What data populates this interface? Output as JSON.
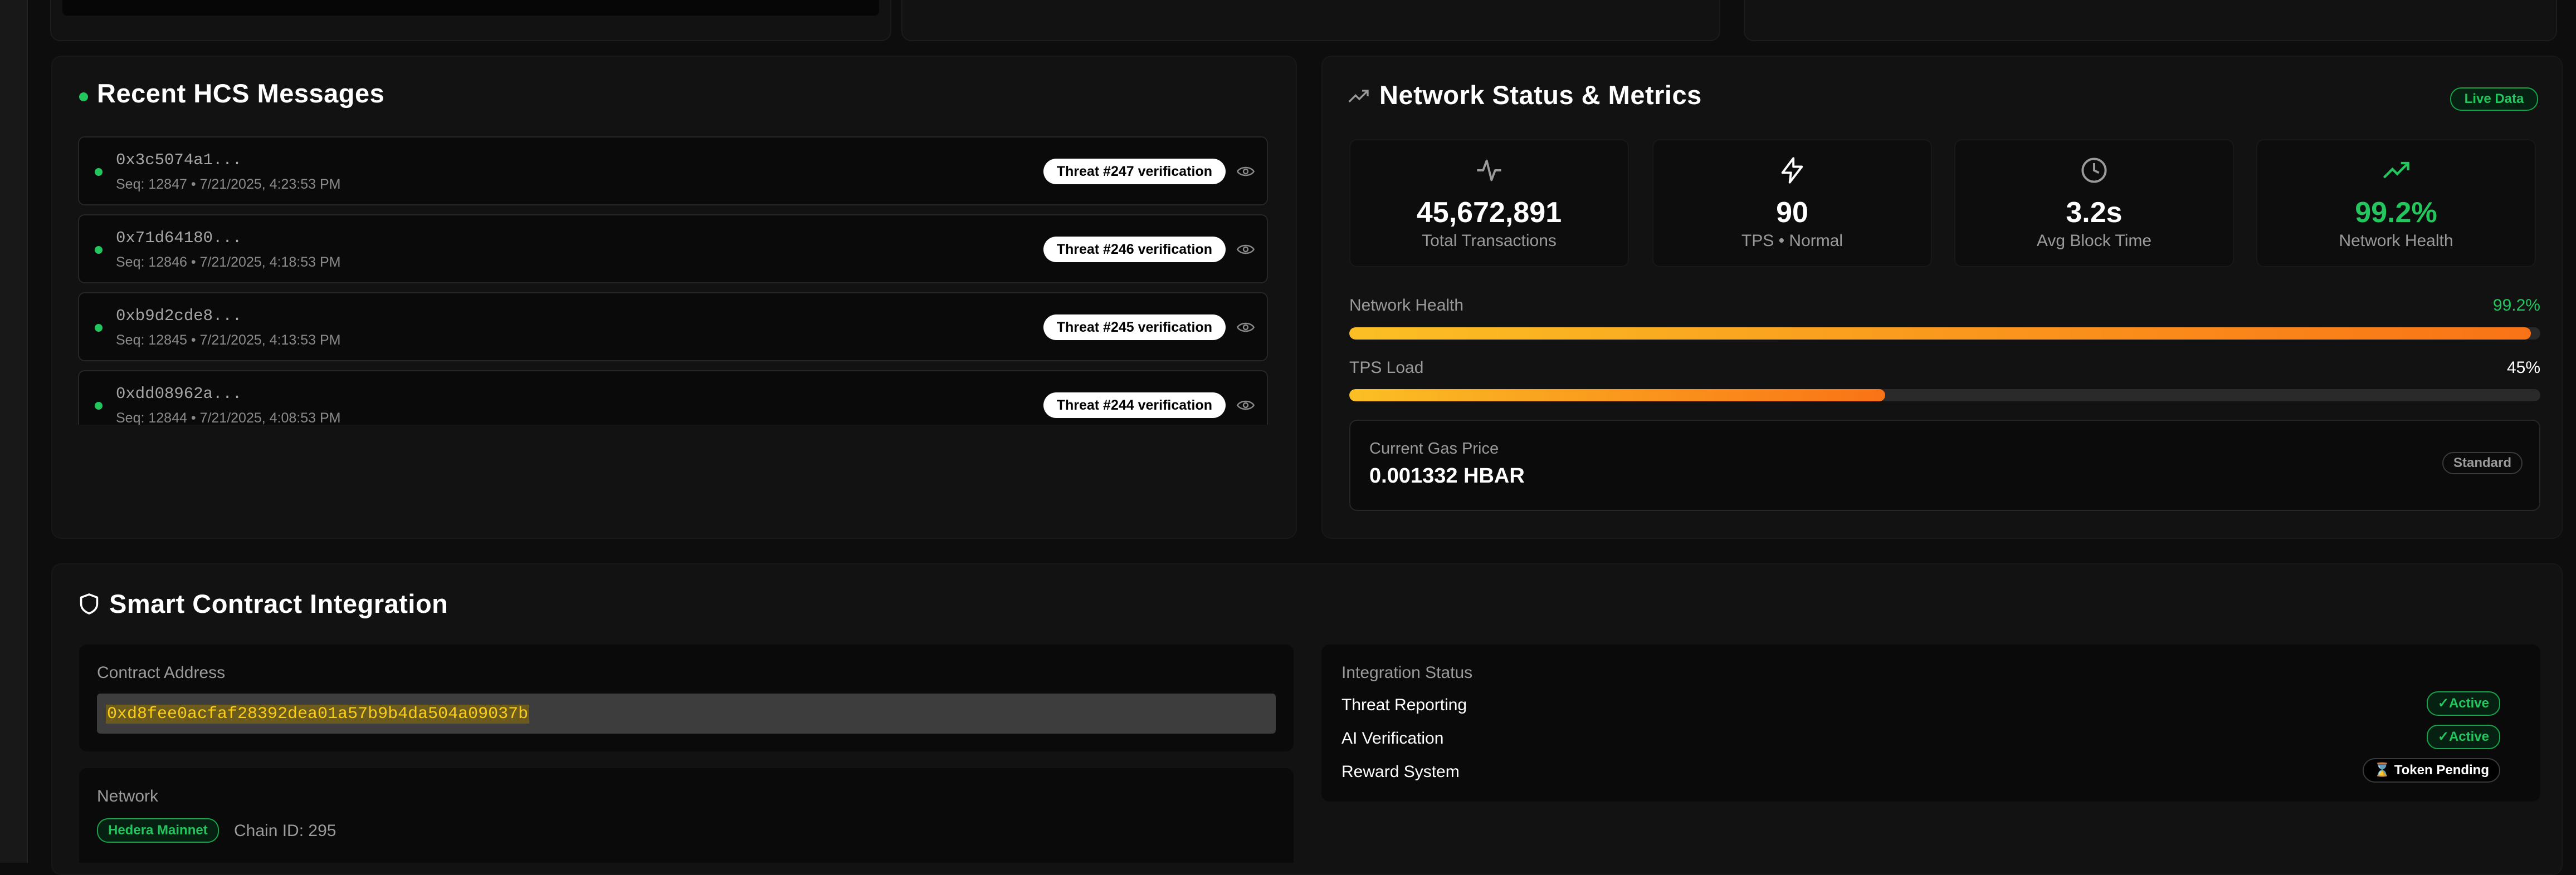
{
  "hcs": {
    "title": "Recent HCS Messages",
    "messages": [
      {
        "hash": "0x3c5074a1...",
        "seq": "Seq: 12847 • 7/21/2025, 4:23:53 PM",
        "badge": "Threat #247 verification"
      },
      {
        "hash": "0x71d64180...",
        "seq": "Seq: 12846 • 7/21/2025, 4:18:53 PM",
        "badge": "Threat #246 verification"
      },
      {
        "hash": "0xb9d2cde8...",
        "seq": "Seq: 12845 • 7/21/2025, 4:13:53 PM",
        "badge": "Threat #245 verification"
      },
      {
        "hash": "0xdd08962a...",
        "seq": "Seq: 12844 • 7/21/2025, 4:08:53 PM",
        "badge": "Threat #244 verification"
      }
    ]
  },
  "network": {
    "title": "Network Status & Metrics",
    "live_badge": "Live Data",
    "metrics": [
      {
        "icon": "activity-icon",
        "value": "45,672,891",
        "label": "Total Transactions"
      },
      {
        "icon": "lightning-icon",
        "value": "90",
        "label": "TPS • Normal"
      },
      {
        "icon": "clock-icon",
        "value": "3.2s",
        "label": "Avg Block Time"
      },
      {
        "icon": "trending-up-icon",
        "value": "99.2%",
        "label": "Network Health"
      }
    ],
    "bars": [
      {
        "label": "Network Health",
        "value_text": "99.2%",
        "fraction": 0.992
      },
      {
        "label": "TPS Load",
        "value_text": "45%",
        "fraction": 0.45
      }
    ],
    "gas": {
      "label": "Current Gas Price",
      "value": "0.001332 HBAR",
      "badge": "Standard"
    }
  },
  "contract": {
    "title": "Smart Contract Integration",
    "address_label": "Contract Address",
    "address": "0xd8fee0acfaf28392dea01a57b9b4da504a09037b",
    "network_label": "Network",
    "network_badge": "Hedera Mainnet",
    "chain_id": "Chain ID: 295",
    "integration_label": "Integration Status",
    "statuses": [
      {
        "label": "Threat Reporting",
        "status": "✓Active"
      },
      {
        "label": "AI Verification",
        "status": "✓Active"
      },
      {
        "label": "Reward System",
        "status": "⌛ Token Pending"
      }
    ]
  },
  "colors": {
    "accent_green": "#22c55e",
    "bar_gradient_start": "#fbbf24",
    "bar_gradient_end": "#f97316",
    "address_text": "#facc15",
    "background": "#0d0d0d"
  }
}
